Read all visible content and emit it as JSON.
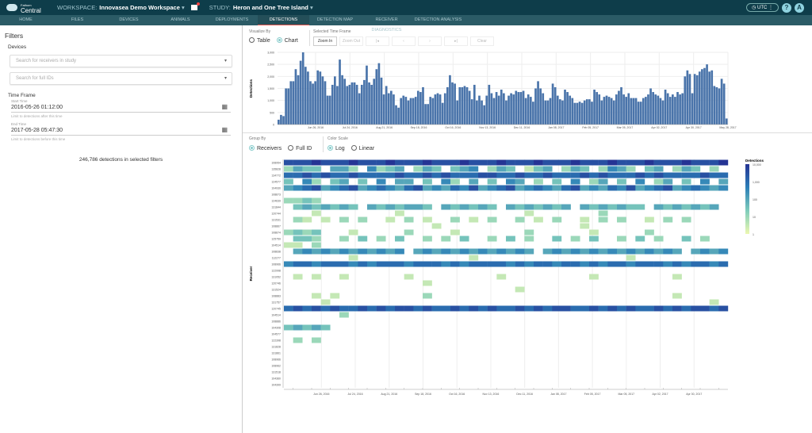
{
  "app": {
    "logo_small": "Fathom",
    "logo_big": "Central",
    "workspace_label": "WORKSPACE:",
    "workspace": "Innovasea Demo Workspace",
    "study_label": "STUDY:",
    "study": "Heron and One Tree Island",
    "timezone": "UTC",
    "help": "?",
    "avatar": "A"
  },
  "nav": [
    "HOME",
    "FILES",
    "DEVICES",
    "ANIMALS",
    "DEPLOYMENTS",
    "DETECTIONS",
    "DETECTION MAP",
    "RECEIVER DIAGNOSTICS",
    "DETECTION ANALYSIS"
  ],
  "nav_active": "DETECTIONS",
  "filters": {
    "title": "Filters",
    "devices": "Devices",
    "receivers_placeholder": "Search for receivers in study",
    "ids_placeholder": "Search for full IDs",
    "time_frame": "Time Frame",
    "start_label": "Start Time",
    "start": "2016-05-26 01:12:00",
    "start_hint": "Limit to detections after this time",
    "end_label": "End Time",
    "end": "2017-05-28 05:47:30",
    "end_hint": "Limit to detections before this time",
    "count": "246,786 detections in selected filters"
  },
  "visualize": {
    "label": "Visualize By",
    "options": [
      "Table",
      "Chart"
    ],
    "selected": "Chart"
  },
  "timeframe": {
    "label": "Selected Time Frame",
    "buttons": [
      "Zoom In",
      "Zoom Out",
      "|◂",
      "‹",
      "›",
      "▸|",
      "Clear"
    ],
    "enabled": [
      true,
      false,
      false,
      false,
      false,
      false,
      false
    ]
  },
  "groupby": {
    "label": "Group By",
    "options": [
      "Receivers",
      "Full ID"
    ],
    "selected": "Receivers"
  },
  "colorscale": {
    "label": "Color Scale",
    "options": [
      "Log",
      "Linear"
    ],
    "selected": "Log"
  },
  "chart_data": [
    {
      "type": "bar",
      "ylabel": "Detections",
      "ylim": [
        0,
        3000
      ],
      "yticks": [
        "0",
        "500",
        "1,000",
        "1,500",
        "2,000",
        "2,500",
        "3,000"
      ],
      "color": "#4a74aa",
      "xrange": [
        "2016-05-26",
        "2017-05-28"
      ],
      "xticks": [
        "Jun 26, 2016",
        "Jul 24, 2016",
        "Aug 21, 2016",
        "Sep 18, 2016",
        "Oct 16, 2016",
        "Nov 13, 2016",
        "Dec 11, 2016",
        "Jan 08, 2017",
        "Feb 05, 2017",
        "Mar 05, 2017",
        "Apr 02, 2017",
        "Apr 30, 2017",
        "May 28, 2017"
      ],
      "values": [
        200,
        400,
        350,
        1500,
        1500,
        1800,
        1800,
        2300,
        2050,
        2650,
        3000,
        2400,
        2200,
        1800,
        1700,
        1800,
        2250,
        2200,
        2000,
        1800,
        1200,
        1200,
        1650,
        2000,
        1600,
        2700,
        2050,
        1900,
        1600,
        1650,
        1750,
        1750,
        1650,
        1300,
        1650,
        1850,
        2450,
        1750,
        1650,
        1900,
        2300,
        2550,
        1950,
        1250,
        1600,
        1300,
        1400,
        1250,
        800,
        700,
        1100,
        1200,
        1150,
        1000,
        1100,
        1100,
        1150,
        1400,
        1350,
        1550,
        850,
        850,
        1150,
        1100,
        1250,
        1300,
        1250,
        900,
        1300,
        1550,
        2050,
        1750,
        1700,
        1000,
        1550,
        1550,
        1600,
        1550,
        1400,
        1050,
        1650,
        1000,
        1200,
        1000,
        800,
        1200,
        1650,
        1300,
        1100,
        1350,
        1200,
        1450,
        1300,
        1000,
        1200,
        1300,
        1250,
        1400,
        1350,
        1350,
        1400,
        1100,
        1250,
        1150,
        950,
        1500,
        1800,
        1500,
        1300,
        1000,
        1000,
        1100,
        1700,
        1550,
        1200,
        1050,
        1000,
        1450,
        1350,
        1200,
        1100,
        900,
        900,
        950,
        900,
        1000,
        1050,
        1050,
        950,
        1450,
        1350,
        1250,
        1000,
        1150,
        1200,
        1150,
        1100,
        1000,
        1250,
        1400,
        1550,
        1250,
        1150,
        1300,
        1100,
        1100,
        1100,
        950,
        950,
        1100,
        1150,
        1250,
        1500,
        1350,
        1250,
        1200,
        1100,
        1000,
        1450,
        1300,
        1150,
        1250,
        1150,
        1350,
        1250,
        1300,
        2000,
        2250,
        2100,
        1300,
        2100,
        2050,
        2200,
        2300,
        2350,
        2500,
        2200,
        2250,
        1600,
        1550,
        1500,
        1900,
        1700,
        250
      ]
    },
    {
      "type": "heatmap",
      "ylabel": "Receiver",
      "scale": "log",
      "legend_title": "Detections",
      "legend_ticks": [
        "10,000",
        "1,000",
        "100",
        "10",
        "1"
      ],
      "colors": [
        "#edf8b1",
        "#7fcdbb",
        "#2c7fb8",
        "#253494"
      ],
      "xticks": [
        "Jun 26, 2016",
        "Jul 24, 2016",
        "Aug 21, 2016",
        "Sep 18, 2016",
        "Oct 16, 2016",
        "Nov 13, 2016",
        "Dec 11, 2016",
        "Jan 08, 2017",
        "Feb 05, 2017",
        "Mar 05, 2017",
        "Apr 02, 2017",
        "Apr 30, 2017"
      ],
      "level_key": "0 = no detections, 1-9 = log level from 1 to 10,000",
      "rows": [
        {
          "id": "108954",
          "z": "888988898889888988898889888988898889888988898889"
        },
        {
          "id": "135828",
          "z": "354405530634503540456035402450354036530450354030"
        },
        {
          "id": "134772",
          "z": "778787787777877878777887787787778787778787777877"
        },
        {
          "id": "124577",
          "z": "406304504060550406305040650304060350406035040605"
        },
        {
          "id": "104930",
          "z": "567856785676578565768567856765785657685678567656"
        },
        {
          "id": "108873",
          "z": "000000000000000000000000000000000000000000000000"
        },
        {
          "id": "124639",
          "z": "334300000000000000000000000000000000000000000000"
        },
        {
          "id": "131844",
          "z": "045454540545455405454540545454505454544054545450"
        },
        {
          "id": "120744",
          "z": "000200000000200000000000002000000030000000000000"
        },
        {
          "id": "131531",
          "z": "032020303002030200302030030203002030300203030000"
        },
        {
          "id": "108867",
          "z": "000000000000000020000000000000002000000000000000"
        },
        {
          "id": "108874",
          "z": "343400020000030000200000003000000200000300000000"
        },
        {
          "id": "125759",
          "z": "044300304030400303040030403004030400304030040300"
        },
        {
          "id": "104514",
          "z": "220300000000000000000000000000000000000000000000"
        },
        {
          "id": "108838",
          "z": "056565656565605656565656565056565656565656505656"
        },
        {
          "id": "112277",
          "z": "000000020000000000002000000000000000020000000000"
        },
        {
          "id": "108966",
          "z": "677677767677767776767777676776776767767776767767"
        },
        {
          "id": "122998",
          "z": "000000000000000000000000000000000000000000000000"
        },
        {
          "id": "131052",
          "z": "020200200000020000000002000000000200000000200000"
        },
        {
          "id": "120746",
          "z": "000000000000000200000000000000000000000000000000"
        },
        {
          "id": "131524",
          "z": "000000000000000000000000020000000000000000000000"
        },
        {
          "id": "108883",
          "z": "000202000000000300000000000000000000000000200000"
        },
        {
          "id": "131757",
          "z": "000020000000000000000000000000000000000000000020"
        },
        {
          "id": "120745",
          "z": "787878778787887877878787787878877878787787878878"
        },
        {
          "id": "104514",
          "z": "000000300000000000000000000000000000000000000000"
        },
        {
          "id": "108886",
          "z": "000000000000000000000000000000000000000000000000"
        },
        {
          "id": "104308",
          "z": "454540000000000000000000000000000000000000000000"
        },
        {
          "id": "104577",
          "z": "000000000000000000000000000000000000000000000000"
        },
        {
          "id": "122398",
          "z": "030300000000000000000000000000000000000000000000"
        },
        {
          "id": "131828",
          "z": "000000000000000000000000000000000000000000000000"
        },
        {
          "id": "131861",
          "z": "000000000000000000000000000000000000000000000000"
        },
        {
          "id": "108966",
          "z": "000000000000000000000000000000000000000000000000"
        },
        {
          "id": "108962",
          "z": "000000000000000000000000000000000000000000000000"
        },
        {
          "id": "131518",
          "z": "000000000000000000000000000000000000000000000000"
        },
        {
          "id": "104360",
          "z": "000000000000000000000000000000000000000000000000"
        },
        {
          "id": "104399",
          "z": "000000000000000000000000000000000000000000000000"
        }
      ]
    }
  ]
}
